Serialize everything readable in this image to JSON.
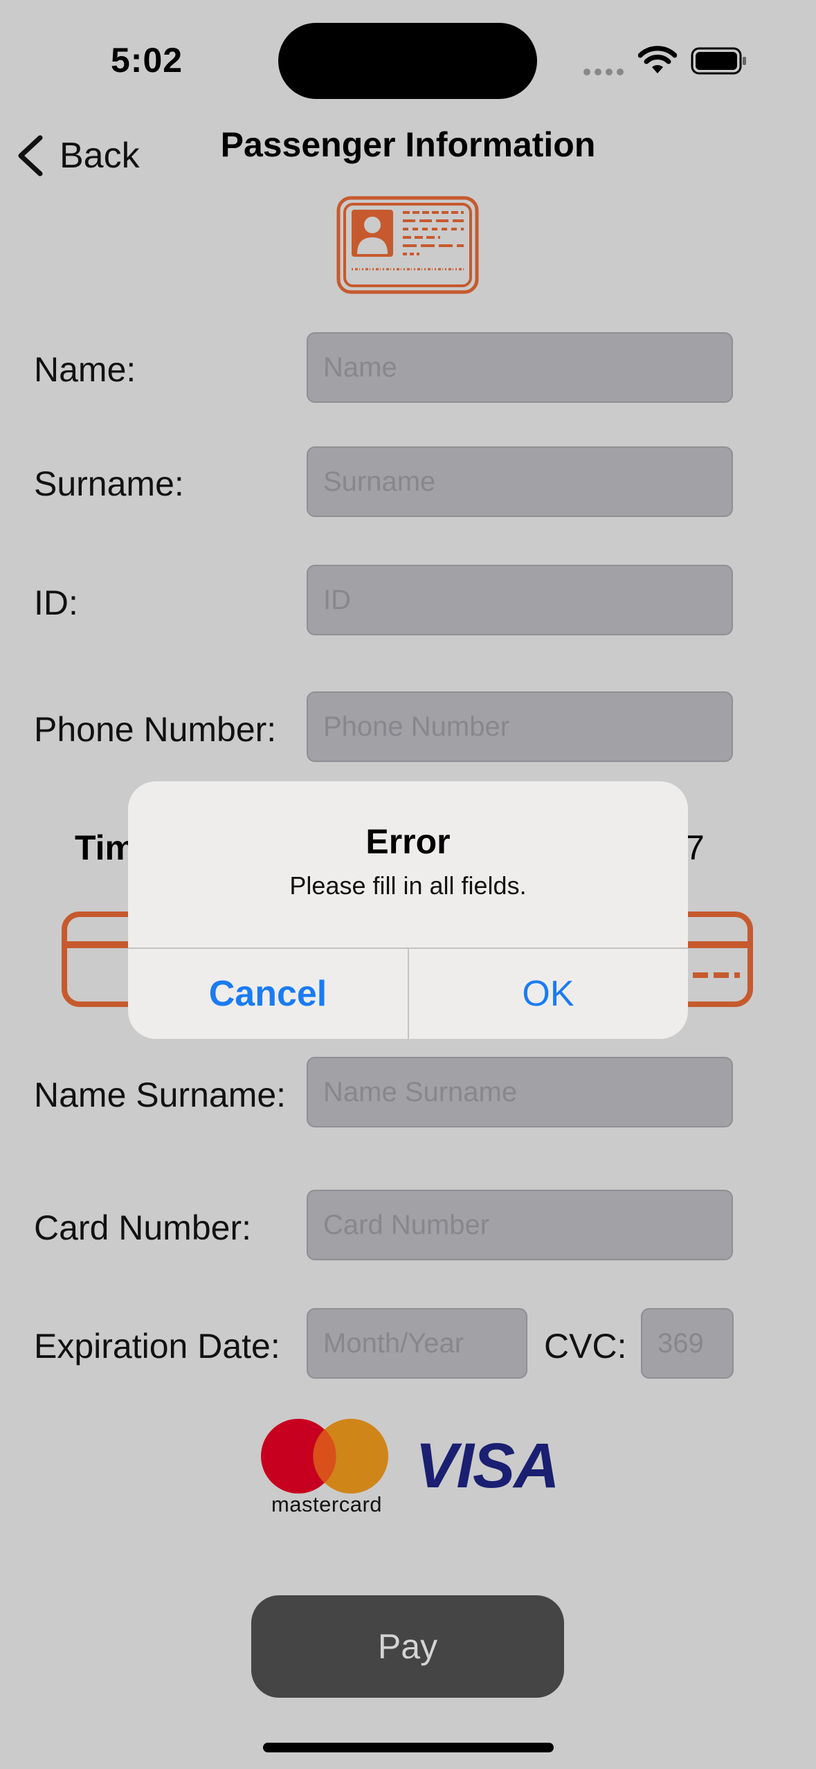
{
  "status_bar": {
    "time": "5:02"
  },
  "nav": {
    "back_label": "Back",
    "title": "Passenger Information"
  },
  "passenger": {
    "name_label": "Name:",
    "name_placeholder": "Name",
    "surname_label": "Surname:",
    "surname_placeholder": "Surname",
    "id_label": "ID:",
    "id_placeholder": "ID",
    "phone_label": "Phone Number:",
    "phone_placeholder": "Phone Number"
  },
  "timer": {
    "left_fragment": "Tim",
    "right_fragment": "7"
  },
  "payment": {
    "name_surname_label": "Name Surname:",
    "name_surname_placeholder": "Name Surname",
    "card_number_label": "Card Number:",
    "card_number_placeholder": "Card Number",
    "expiration_label": "Expiration Date:",
    "expiration_placeholder": "Month/Year",
    "cvc_label": "CVC:",
    "cvc_placeholder": "369"
  },
  "logos": {
    "mastercard": "mastercard",
    "visa": "VISA"
  },
  "pay_button": "Pay",
  "alert": {
    "title": "Error",
    "message": "Please fill in all fields.",
    "cancel": "Cancel",
    "ok": "OK"
  },
  "colors": {
    "accent": "#c65a2e",
    "link_blue": "#1a7cf2",
    "visa_blue": "#1a1f71"
  }
}
